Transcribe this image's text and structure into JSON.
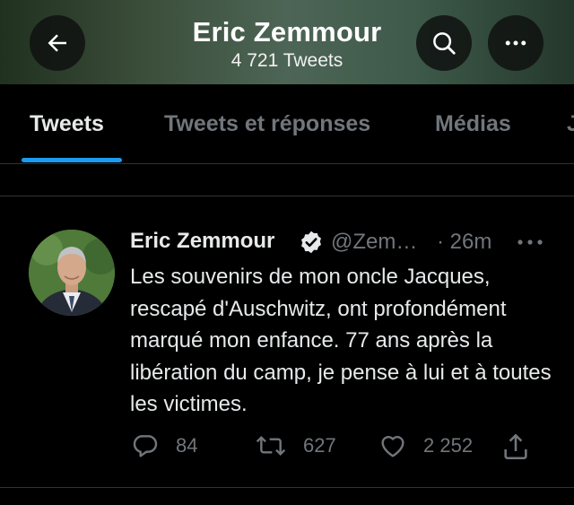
{
  "header": {
    "title": "Eric Zemmour",
    "tweet_count": "4 721 Tweets",
    "back_icon": "arrow-left-icon",
    "search_icon": "search-icon",
    "more_icon": "more-horizontal-icon"
  },
  "tabs": [
    {
      "label": "Tweets",
      "active": true
    },
    {
      "label": "Tweets et réponses",
      "active": false
    },
    {
      "label": "Médias",
      "active": false
    },
    {
      "label": "J",
      "active": false
    }
  ],
  "tweet": {
    "author_name": "Eric Zemmour",
    "verified": true,
    "handle": "@Zem…",
    "time": "· 26m",
    "text": "Les souvenirs de mon oncle Jacques, rescapé d'Auschwitz, ont profondément marqué mon enfance. 77 ans après la libération du camp, je pense à lui et à toutes les victimes.",
    "replies": "84",
    "retweets": "627",
    "likes": "2 252"
  },
  "colors": {
    "accent": "#1d9bf0",
    "muted": "#71767b",
    "text": "#e7e9ea",
    "background": "#000000"
  }
}
